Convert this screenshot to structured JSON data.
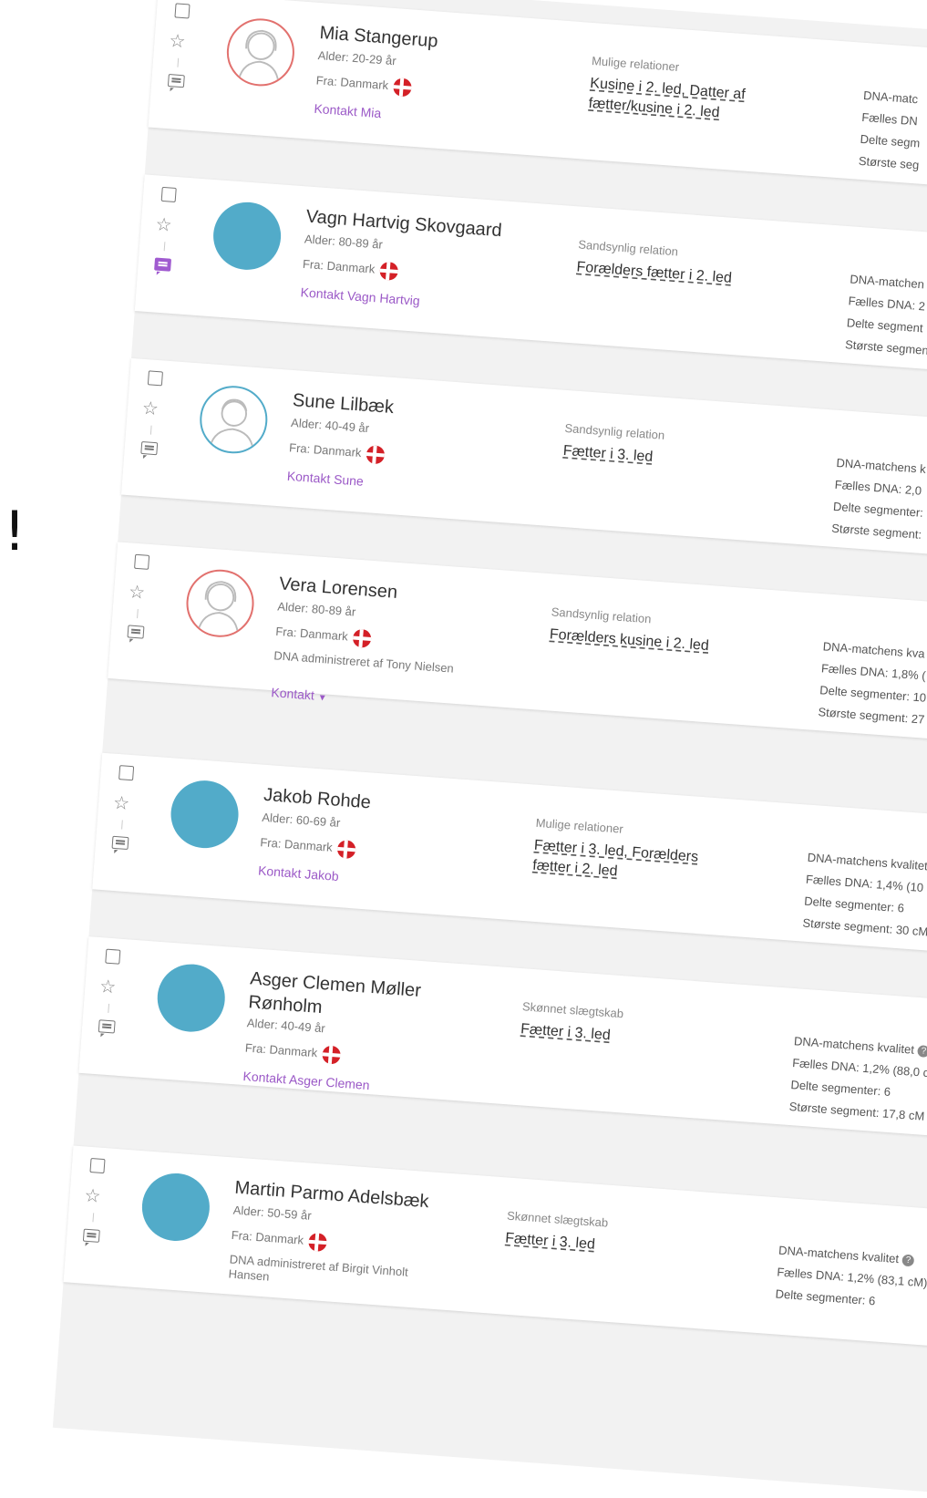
{
  "side_mark": "!",
  "matches": [
    {
      "name": "Mia Stangerup",
      "age": "Alder: 20-29 år",
      "from": "Fra: Danmark",
      "admin": "",
      "contact": "Kontakt Mia",
      "contact_dropdown": false,
      "avatar": "female",
      "message_active": false,
      "relation_label": "Mulige relationer",
      "relation_value": "Kusine i 2. led, Datter af fætter/kusine i 2. led",
      "dna_title": "DNA-matc",
      "dna_title_help": false,
      "dna_shared": "Fælles DN",
      "dna_segments": "Delte segm",
      "dna_largest": "Største seg"
    },
    {
      "name": "Vagn Hartvig Skovgaard",
      "age": "Alder: 80-89 år",
      "from": "Fra: Danmark",
      "admin": "",
      "contact": "Kontakt Vagn Hartvig",
      "contact_dropdown": false,
      "avatar": "filled",
      "message_active": true,
      "relation_label": "Sandsynlig relation",
      "relation_value": "Forælders fætter i 2. led",
      "dna_title": "DNA-matchen",
      "dna_title_help": false,
      "dna_shared": "Fælles DNA: 2",
      "dna_segments": "Delte segment",
      "dna_largest": "Største segmen"
    },
    {
      "name": "Sune Lilbæk",
      "age": "Alder: 40-49 år",
      "from": "Fra: Danmark",
      "admin": "",
      "contact": "Kontakt Sune",
      "contact_dropdown": false,
      "avatar": "male",
      "message_active": false,
      "relation_label": "Sandsynlig relation",
      "relation_value": "Fætter i 3. led",
      "dna_title": "DNA-matchens k",
      "dna_title_help": false,
      "dna_shared": "Fælles DNA: 2,0",
      "dna_segments": "Delte segmenter:",
      "dna_largest": "Største segment:"
    },
    {
      "name": "Vera Lorensen",
      "age": "Alder: 80-89 år",
      "from": "Fra: Danmark",
      "admin": "DNA administreret af Tony Nielsen",
      "contact": "Kontakt",
      "contact_dropdown": true,
      "avatar": "female",
      "message_active": false,
      "relation_label": "Sandsynlig relation",
      "relation_value": "Forælders kusine i 2. led",
      "dna_title": "DNA-matchens kva",
      "dna_title_help": false,
      "dna_shared": "Fælles DNA: 1,8% (",
      "dna_segments": "Delte segmenter: 10",
      "dna_largest": "Største segment: 27"
    },
    {
      "name": "Jakob Rohde",
      "age": "Alder: 60-69 år",
      "from": "Fra: Danmark",
      "admin": "",
      "contact": "Kontakt Jakob",
      "contact_dropdown": false,
      "avatar": "filled",
      "message_active": false,
      "relation_label": "Mulige relationer",
      "relation_value": "Fætter i 3. led, Forælders fætter i 2. led",
      "dna_title": "DNA-matchens kvalitet",
      "dna_title_help": false,
      "dna_shared": "Fælles DNA: 1,4% (10",
      "dna_segments": "Delte segmenter: 6",
      "dna_largest": "Største segment: 30 cM"
    },
    {
      "name": "Asger Clemen Møller Rønholm",
      "age": "Alder: 40-49 år",
      "from": "Fra: Danmark",
      "admin": "",
      "contact": "Kontakt Asger Clemen",
      "contact_dropdown": false,
      "avatar": "filled",
      "message_active": false,
      "relation_label": "Skønnet slægtskab",
      "relation_value": "Fætter i 3. led",
      "dna_title": "DNA-matchens kvalitet",
      "dna_title_help": true,
      "dna_shared": "Fælles DNA: 1,2% (88,0 c",
      "dna_segments": "Delte segmenter: 6",
      "dna_largest": "Største segment: 17,8 cM"
    },
    {
      "name": "Martin Parmo Adelsbæk",
      "age": "Alder: 50-59 år",
      "from": "Fra: Danmark",
      "admin": "DNA administreret af Birgit Vinholt Hansen",
      "contact": "",
      "contact_dropdown": false,
      "avatar": "filled",
      "message_active": false,
      "relation_label": "Skønnet slægtskab",
      "relation_value": "Fætter i 3. led",
      "dna_title": "DNA-matchens kvalitet",
      "dna_title_help": true,
      "dna_shared": "Fælles DNA: 1,2% (83,1 cM)",
      "dna_segments": "Delte segmenter: 6",
      "dna_largest": ""
    }
  ],
  "colors": {
    "accent_purple": "#9b59c7",
    "avatar_blue": "#52abc9",
    "female_border": "#e2716e",
    "flag_red": "#d42027"
  },
  "icons": {
    "checkbox": "checkbox-icon",
    "star": "star-icon",
    "message": "message-icon",
    "flag": "denmark-flag-icon",
    "help": "help-icon"
  }
}
